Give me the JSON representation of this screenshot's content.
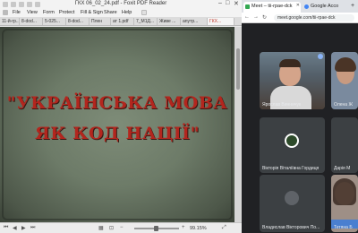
{
  "pdf_reader": {
    "window_title": "ГКХ 06_02_24.pdf - Foxit PDF Reader",
    "menu": [
      "File",
      "View",
      "Form",
      "Protect",
      "Fill & Sign",
      "Share",
      "Help"
    ],
    "tabs": [
      "11-й-гр...",
      "8-dod...",
      "5-025...",
      "8-dod...",
      "Плен",
      "ат 1.pdf",
      "7_М1Д...",
      "Живе ...",
      "anyтр...",
      "ГКХ..."
    ],
    "active_tab_index": 9,
    "slide_title_line1": "\"УКРАЇНСЬКА МОВА",
    "slide_title_line2": "ЯК КОД НАЦІЇ\"",
    "zoom_label": "99.15%"
  },
  "chrome": {
    "tabs": [
      {
        "label": "Meet – tii-rpae-dck",
        "active": true
      },
      {
        "label": "Google Acco",
        "active": false
      }
    ],
    "address": "meet.google.com/tii-rpae-dck"
  },
  "meet": {
    "participants": [
      {
        "name": "Ярослав Винничук"
      },
      {
        "name": "Олена Ж"
      },
      {
        "name": "Вікторія Віталіївна Гордиця"
      },
      {
        "name": "Дарія М"
      },
      {
        "name": "Владислав Вікторович По..."
      },
      {
        "name": "Тетяна Б"
      }
    ]
  },
  "colors": {
    "slide_title": "#b3261e",
    "slide_background": "#6d7b68",
    "meet_background": "#202124"
  }
}
